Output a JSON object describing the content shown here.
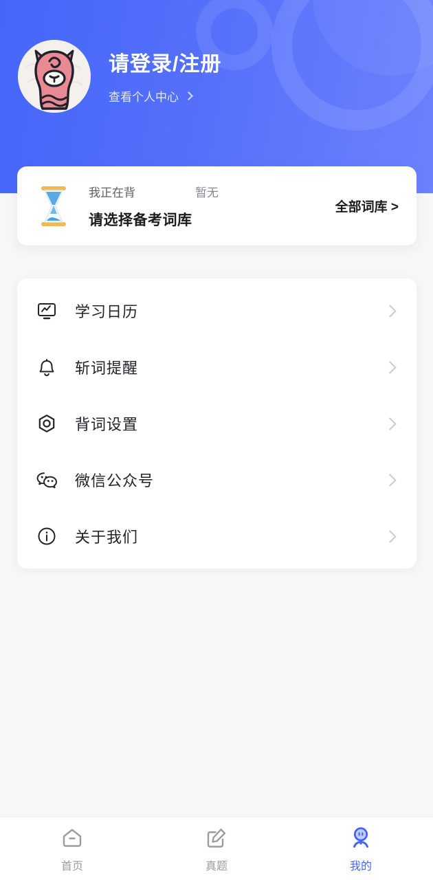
{
  "theme": {
    "brand_blue": "#4666FA",
    "brand_blue_light": "#6B81FD",
    "page_background": "#F7F7F8",
    "card_background": "#FFFFFF",
    "text_primary": "#23242A",
    "text_secondary": "#86888E",
    "chevron_gray": "#C9CACE",
    "tab_active": "#4666FA",
    "tab_inactive": "#9A9CA2"
  },
  "header": {
    "avatar_icon": "alpaca-avatar-icon",
    "login_title": "请登录/注册",
    "profile_center_link": "查看个人中心",
    "profile_center_chevron": "chevron-right-icon"
  },
  "wordbank": {
    "icon": "hourglass-icon",
    "label": "我正在背",
    "value": "暂无",
    "title": "请选择备考词库",
    "all_link": "全部词库 >"
  },
  "menu": {
    "items": [
      {
        "label": "学习日历",
        "icon": "monitor-chart-icon"
      },
      {
        "label": "斩词提醒",
        "icon": "bell-icon"
      },
      {
        "label": "背词设置",
        "icon": "hex-gear-icon"
      },
      {
        "label": "微信公众号",
        "icon": "wechat-icon"
      },
      {
        "label": "关于我们",
        "icon": "info-circle-icon"
      }
    ],
    "chevron": "chevron-right-icon"
  },
  "tabbar": {
    "tabs": [
      {
        "label": "首页",
        "icon": "home-icon",
        "active": false
      },
      {
        "label": "真题",
        "icon": "edit-square-icon",
        "active": false
      },
      {
        "label": "我的",
        "icon": "person-icon",
        "active": true
      }
    ]
  }
}
